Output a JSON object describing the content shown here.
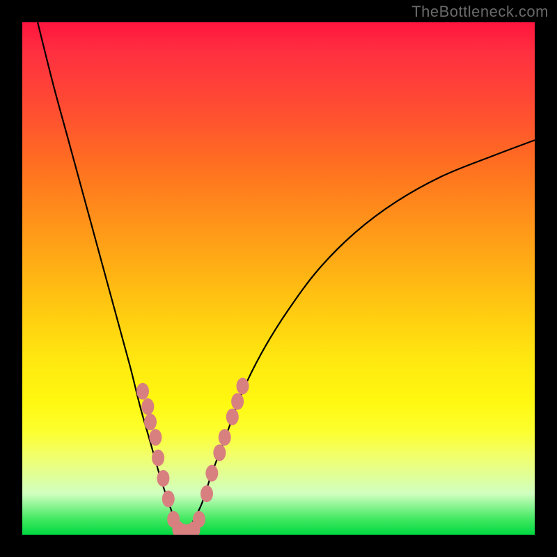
{
  "watermark": "TheBottleneck.com",
  "chart_data": {
    "type": "line",
    "title": "",
    "xlabel": "",
    "ylabel": "",
    "xlim": [
      0,
      100
    ],
    "ylim": [
      0,
      100
    ],
    "series": [
      {
        "name": "bottleneck-curve",
        "x": [
          3,
          6,
          9,
          12,
          15,
          18,
          21,
          23,
          25,
          27,
          29,
          30,
          31,
          32,
          33,
          35,
          37,
          40,
          43,
          47,
          52,
          58,
          65,
          73,
          82,
          92,
          100
        ],
        "y": [
          100,
          88,
          77,
          66,
          55,
          44,
          33,
          25,
          18,
          11,
          5,
          2,
          0,
          0,
          2,
          6,
          12,
          20,
          28,
          36,
          44,
          52,
          59,
          65,
          70,
          74,
          77
        ]
      }
    ],
    "markers": {
      "name": "highlight-dots",
      "color": "#d88080",
      "points": [
        {
          "x": 23.5,
          "y": 28
        },
        {
          "x": 24.5,
          "y": 25
        },
        {
          "x": 25.0,
          "y": 22
        },
        {
          "x": 26.0,
          "y": 19
        },
        {
          "x": 26.5,
          "y": 15
        },
        {
          "x": 27.5,
          "y": 11
        },
        {
          "x": 28.5,
          "y": 7
        },
        {
          "x": 29.5,
          "y": 3
        },
        {
          "x": 30.5,
          "y": 1
        },
        {
          "x": 31.5,
          "y": 0.5
        },
        {
          "x": 32.5,
          "y": 0.5
        },
        {
          "x": 33.5,
          "y": 1
        },
        {
          "x": 34.5,
          "y": 3
        },
        {
          "x": 36.0,
          "y": 8
        },
        {
          "x": 37.0,
          "y": 12
        },
        {
          "x": 38.5,
          "y": 16
        },
        {
          "x": 39.5,
          "y": 19
        },
        {
          "x": 41.0,
          "y": 23
        },
        {
          "x": 42.0,
          "y": 26
        },
        {
          "x": 43.0,
          "y": 29
        }
      ]
    },
    "gradient_stops": [
      {
        "offset": 0,
        "color": "#ff153e"
      },
      {
        "offset": 50,
        "color": "#ffc010"
      },
      {
        "offset": 80,
        "color": "#fff810"
      },
      {
        "offset": 100,
        "color": "#00d840"
      }
    ]
  }
}
